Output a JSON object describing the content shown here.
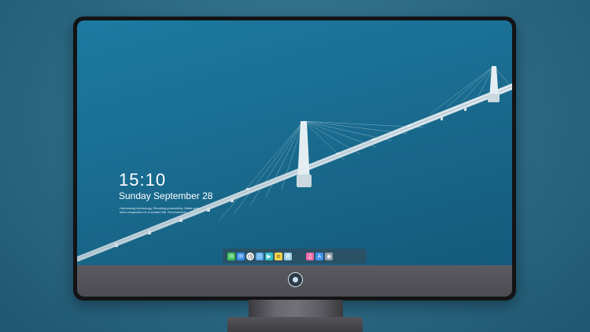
{
  "lock_screen": {
    "time": "15:10",
    "date": "Sunday September 28",
    "tagline": "Harnessing technology, Elevating productivity. Make your ideal companion for a smarter life. Revolutionize"
  },
  "dock": {
    "icons": [
      {
        "name": "messages-icon",
        "color": "#3fbf5a",
        "glyph": "✉"
      },
      {
        "name": "mail-icon",
        "color": "#3a8ee6",
        "glyph": "✉"
      },
      {
        "name": "clock-icon",
        "color": "#f2f2f2",
        "glyph": "◷"
      },
      {
        "name": "finder-icon",
        "color": "#5aa7e6",
        "glyph": "☺"
      },
      {
        "name": "clapper-icon",
        "color": "#37c0c9",
        "glyph": "▶"
      },
      {
        "name": "notes-icon",
        "color": "#f4d34a",
        "glyph": "≡"
      },
      {
        "name": "photos-icon",
        "color": "#9bd2e6",
        "glyph": "✿"
      },
      {
        "name": "music-icon",
        "color": "#ef6aa6",
        "glyph": "♫"
      },
      {
        "name": "app-store-icon",
        "color": "#3d8fe8",
        "glyph": "A"
      },
      {
        "name": "camera-icon",
        "color": "#8f9aa5",
        "glyph": "◉"
      }
    ]
  },
  "colors": {
    "background": "#2c6882",
    "sea": "#1a6e93",
    "monitor_bezel": "#131315",
    "chin": "#56555b"
  }
}
